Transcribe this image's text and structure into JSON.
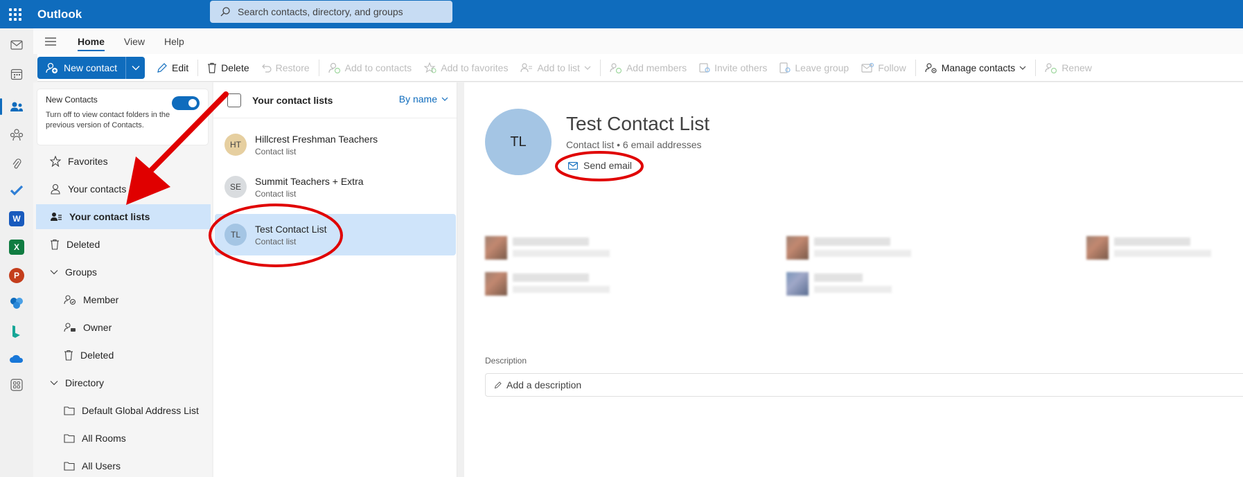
{
  "app": {
    "title": "Outlook"
  },
  "search": {
    "placeholder": "Search contacts, directory, and groups"
  },
  "ribbon": {
    "tabs": [
      "Home",
      "View",
      "Help"
    ],
    "new_contact": "New contact",
    "edit": "Edit",
    "delete": "Delete",
    "restore": "Restore",
    "add_to_contacts": "Add to contacts",
    "add_to_favorites": "Add to favorites",
    "add_to_list": "Add to list",
    "add_members": "Add members",
    "invite_others": "Invite others",
    "leave_group": "Leave group",
    "follow": "Follow",
    "manage_contacts": "Manage contacts",
    "renew": "Renew"
  },
  "toggle": {
    "title": "New Contacts",
    "description": "Turn off to view contact folders in the previous version of Contacts."
  },
  "nav": {
    "favorites": "Favorites",
    "your_contacts": "Your contacts",
    "your_contact_lists": "Your contact lists",
    "deleted": "Deleted",
    "groups": "Groups",
    "member": "Member",
    "owner": "Owner",
    "groups_deleted": "Deleted",
    "directory": "Directory",
    "default_gal": "Default Global Address List",
    "all_rooms": "All Rooms",
    "all_users": "All Users"
  },
  "list": {
    "header": "Your contact lists",
    "sort": "By name",
    "items": [
      {
        "initials": "HT",
        "name": "Hillcrest Freshman Teachers",
        "type": "Contact list"
      },
      {
        "initials": "SE",
        "name": "Summit Teachers + Extra",
        "type": "Contact list"
      },
      {
        "initials": "TL",
        "name": "Test Contact List",
        "type": "Contact list"
      }
    ]
  },
  "detail": {
    "initials": "TL",
    "title": "Test Contact List",
    "subtitle": "Contact list • 6 email addresses",
    "send_email": "Send email",
    "description_label": "Description",
    "description_placeholder": "Add a description"
  },
  "colors": {
    "brand": "#0f6cbd",
    "selected": "#cfe4fa",
    "annotation": "#e00000"
  }
}
